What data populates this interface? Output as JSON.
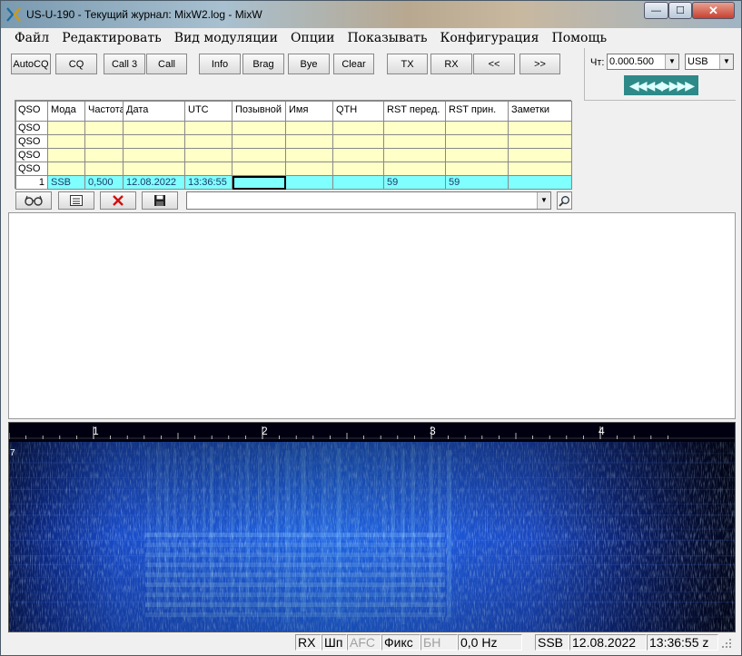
{
  "window": {
    "title": "US-U-190 - Текущий журнал: MixW2.log - MixW",
    "min_glyph": "—",
    "max_glyph": "☐",
    "close_glyph": "✕"
  },
  "menu": [
    "Файл",
    "Редактировать",
    "Вид модуляции",
    "Опции",
    "Показывать",
    "Конфигурация",
    "Помощь"
  ],
  "toolbar": {
    "buttons": [
      "AutoCQ",
      "CQ",
      "Call 3",
      "Call",
      "Info",
      "Brag",
      "Bye",
      "Clear",
      "TX",
      "RX",
      "<<",
      ">>"
    ]
  },
  "right_panel": {
    "freq_label": "Чт:",
    "freq_value": "0.000.500",
    "mode_value": "USB",
    "tune_glyphs": "◀◀◀◀▶▶▶▶"
  },
  "log": {
    "columns": [
      "QSO",
      "Мода",
      "Частота",
      "Дата",
      "UTC",
      "Позывной",
      "Имя",
      "QTH",
      "RST перед.",
      "RST прин.",
      "Заметки"
    ],
    "empty_row_label": "QSO",
    "active": {
      "num": "1",
      "mode": "SSB",
      "freq": "0,500",
      "date": "12.08.2022",
      "utc": "13:36:55",
      "call": "",
      "name": "",
      "qth": "",
      "rst_sent": "59",
      "rst_rcvd": "59",
      "notes": ""
    }
  },
  "spectrum": {
    "scale_labels": [
      "1",
      "2",
      "3",
      "4"
    ],
    "side_marker": "7",
    "accent": "#1a60d8"
  },
  "status": {
    "rx": "RX",
    "shp": "Шп",
    "afc": "AFC",
    "fix": "Фикс",
    "bn": "БН",
    "offset": "0,0 Hz",
    "mode": "SSB",
    "date": "12.08.2022",
    "time": "13:36:55 z"
  }
}
